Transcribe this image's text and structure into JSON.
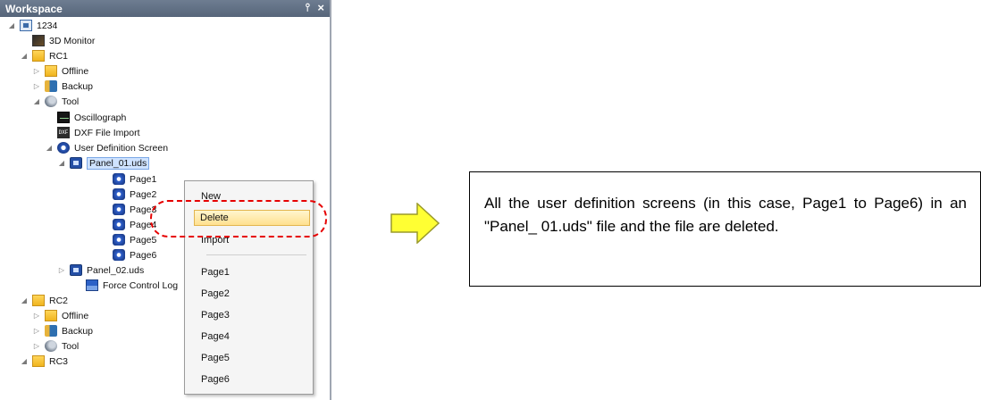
{
  "workspace": {
    "title": "Workspace",
    "pin_glyph": "Ͱ",
    "close_glyph": "×"
  },
  "tree": {
    "project": "1234",
    "monitor": "3D Monitor",
    "rc1": "RC1",
    "offline": "Offline",
    "backup": "Backup",
    "tool": "Tool",
    "oscillograph": "Oscillograph",
    "dxf_import": "DXF File Import",
    "dxf_icon_text": "DXF",
    "user_def": "User Definition Screen",
    "panel01": "Panel_01.uds",
    "pages": [
      "Page1",
      "Page2",
      "Page3",
      "Page4",
      "Page5",
      "Page6"
    ],
    "panel02": "Panel_02.uds",
    "force_control": "Force Control Log",
    "rc2": "RC2",
    "rc2_offline": "Offline",
    "rc2_backup": "Backup",
    "rc2_tool": "Tool",
    "rc3": "RC3"
  },
  "context_menu": {
    "new": "New",
    "delete": "Delete",
    "import": "Import",
    "pages": [
      "Page1",
      "Page2",
      "Page3",
      "Page4",
      "Page5",
      "Page6"
    ]
  },
  "callout": {
    "text": "All the user definition screens (in this case, Page1 to Page6) in an \"Panel_ 01.uds\" file and the file are deleted."
  },
  "colors": {
    "highlight": "#e60000",
    "arrow_fill": "#ffff33",
    "menu_active": "#ffe08f",
    "selection": "#cfe3ff"
  }
}
